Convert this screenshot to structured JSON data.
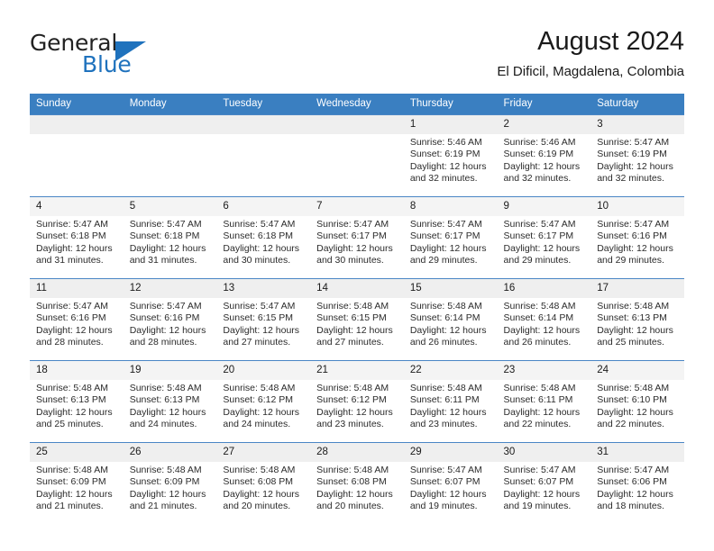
{
  "brand": {
    "name_part1": "General",
    "name_part2": "Blue",
    "accent_color": "#1f72bd"
  },
  "header": {
    "title": "August 2024",
    "subtitle": "El Dificil, Magdalena, Colombia"
  },
  "calendar": {
    "header_bg": "#3a7fc1",
    "weekday_headers": [
      "Sunday",
      "Monday",
      "Tuesday",
      "Wednesday",
      "Thursday",
      "Friday",
      "Saturday"
    ],
    "weeks": [
      [
        {
          "day": "",
          "empty": true,
          "sunrise": "",
          "sunset": "",
          "daylight1": "",
          "daylight2": ""
        },
        {
          "day": "",
          "empty": true,
          "sunrise": "",
          "sunset": "",
          "daylight1": "",
          "daylight2": ""
        },
        {
          "day": "",
          "empty": true,
          "sunrise": "",
          "sunset": "",
          "daylight1": "",
          "daylight2": ""
        },
        {
          "day": "",
          "empty": true,
          "sunrise": "",
          "sunset": "",
          "daylight1": "",
          "daylight2": ""
        },
        {
          "day": "1",
          "sunrise": "Sunrise: 5:46 AM",
          "sunset": "Sunset: 6:19 PM",
          "daylight1": "Daylight: 12 hours",
          "daylight2": "and 32 minutes."
        },
        {
          "day": "2",
          "sunrise": "Sunrise: 5:46 AM",
          "sunset": "Sunset: 6:19 PM",
          "daylight1": "Daylight: 12 hours",
          "daylight2": "and 32 minutes."
        },
        {
          "day": "3",
          "sunrise": "Sunrise: 5:47 AM",
          "sunset": "Sunset: 6:19 PM",
          "daylight1": "Daylight: 12 hours",
          "daylight2": "and 32 minutes."
        }
      ],
      [
        {
          "day": "4",
          "sunrise": "Sunrise: 5:47 AM",
          "sunset": "Sunset: 6:18 PM",
          "daylight1": "Daylight: 12 hours",
          "daylight2": "and 31 minutes."
        },
        {
          "day": "5",
          "sunrise": "Sunrise: 5:47 AM",
          "sunset": "Sunset: 6:18 PM",
          "daylight1": "Daylight: 12 hours",
          "daylight2": "and 31 minutes."
        },
        {
          "day": "6",
          "sunrise": "Sunrise: 5:47 AM",
          "sunset": "Sunset: 6:18 PM",
          "daylight1": "Daylight: 12 hours",
          "daylight2": "and 30 minutes."
        },
        {
          "day": "7",
          "sunrise": "Sunrise: 5:47 AM",
          "sunset": "Sunset: 6:17 PM",
          "daylight1": "Daylight: 12 hours",
          "daylight2": "and 30 minutes."
        },
        {
          "day": "8",
          "sunrise": "Sunrise: 5:47 AM",
          "sunset": "Sunset: 6:17 PM",
          "daylight1": "Daylight: 12 hours",
          "daylight2": "and 29 minutes."
        },
        {
          "day": "9",
          "sunrise": "Sunrise: 5:47 AM",
          "sunset": "Sunset: 6:17 PM",
          "daylight1": "Daylight: 12 hours",
          "daylight2": "and 29 minutes."
        },
        {
          "day": "10",
          "sunrise": "Sunrise: 5:47 AM",
          "sunset": "Sunset: 6:16 PM",
          "daylight1": "Daylight: 12 hours",
          "daylight2": "and 29 minutes."
        }
      ],
      [
        {
          "day": "11",
          "sunrise": "Sunrise: 5:47 AM",
          "sunset": "Sunset: 6:16 PM",
          "daylight1": "Daylight: 12 hours",
          "daylight2": "and 28 minutes."
        },
        {
          "day": "12",
          "sunrise": "Sunrise: 5:47 AM",
          "sunset": "Sunset: 6:16 PM",
          "daylight1": "Daylight: 12 hours",
          "daylight2": "and 28 minutes."
        },
        {
          "day": "13",
          "sunrise": "Sunrise: 5:47 AM",
          "sunset": "Sunset: 6:15 PM",
          "daylight1": "Daylight: 12 hours",
          "daylight2": "and 27 minutes."
        },
        {
          "day": "14",
          "sunrise": "Sunrise: 5:48 AM",
          "sunset": "Sunset: 6:15 PM",
          "daylight1": "Daylight: 12 hours",
          "daylight2": "and 27 minutes."
        },
        {
          "day": "15",
          "sunrise": "Sunrise: 5:48 AM",
          "sunset": "Sunset: 6:14 PM",
          "daylight1": "Daylight: 12 hours",
          "daylight2": "and 26 minutes."
        },
        {
          "day": "16",
          "sunrise": "Sunrise: 5:48 AM",
          "sunset": "Sunset: 6:14 PM",
          "daylight1": "Daylight: 12 hours",
          "daylight2": "and 26 minutes."
        },
        {
          "day": "17",
          "sunrise": "Sunrise: 5:48 AM",
          "sunset": "Sunset: 6:13 PM",
          "daylight1": "Daylight: 12 hours",
          "daylight2": "and 25 minutes."
        }
      ],
      [
        {
          "day": "18",
          "sunrise": "Sunrise: 5:48 AM",
          "sunset": "Sunset: 6:13 PM",
          "daylight1": "Daylight: 12 hours",
          "daylight2": "and 25 minutes."
        },
        {
          "day": "19",
          "sunrise": "Sunrise: 5:48 AM",
          "sunset": "Sunset: 6:13 PM",
          "daylight1": "Daylight: 12 hours",
          "daylight2": "and 24 minutes."
        },
        {
          "day": "20",
          "sunrise": "Sunrise: 5:48 AM",
          "sunset": "Sunset: 6:12 PM",
          "daylight1": "Daylight: 12 hours",
          "daylight2": "and 24 minutes."
        },
        {
          "day": "21",
          "sunrise": "Sunrise: 5:48 AM",
          "sunset": "Sunset: 6:12 PM",
          "daylight1": "Daylight: 12 hours",
          "daylight2": "and 23 minutes."
        },
        {
          "day": "22",
          "sunrise": "Sunrise: 5:48 AM",
          "sunset": "Sunset: 6:11 PM",
          "daylight1": "Daylight: 12 hours",
          "daylight2": "and 23 minutes."
        },
        {
          "day": "23",
          "sunrise": "Sunrise: 5:48 AM",
          "sunset": "Sunset: 6:11 PM",
          "daylight1": "Daylight: 12 hours",
          "daylight2": "and 22 minutes."
        },
        {
          "day": "24",
          "sunrise": "Sunrise: 5:48 AM",
          "sunset": "Sunset: 6:10 PM",
          "daylight1": "Daylight: 12 hours",
          "daylight2": "and 22 minutes."
        }
      ],
      [
        {
          "day": "25",
          "sunrise": "Sunrise: 5:48 AM",
          "sunset": "Sunset: 6:09 PM",
          "daylight1": "Daylight: 12 hours",
          "daylight2": "and 21 minutes."
        },
        {
          "day": "26",
          "sunrise": "Sunrise: 5:48 AM",
          "sunset": "Sunset: 6:09 PM",
          "daylight1": "Daylight: 12 hours",
          "daylight2": "and 21 minutes."
        },
        {
          "day": "27",
          "sunrise": "Sunrise: 5:48 AM",
          "sunset": "Sunset: 6:08 PM",
          "daylight1": "Daylight: 12 hours",
          "daylight2": "and 20 minutes."
        },
        {
          "day": "28",
          "sunrise": "Sunrise: 5:48 AM",
          "sunset": "Sunset: 6:08 PM",
          "daylight1": "Daylight: 12 hours",
          "daylight2": "and 20 minutes."
        },
        {
          "day": "29",
          "sunrise": "Sunrise: 5:47 AM",
          "sunset": "Sunset: 6:07 PM",
          "daylight1": "Daylight: 12 hours",
          "daylight2": "and 19 minutes."
        },
        {
          "day": "30",
          "sunrise": "Sunrise: 5:47 AM",
          "sunset": "Sunset: 6:07 PM",
          "daylight1": "Daylight: 12 hours",
          "daylight2": "and 19 minutes."
        },
        {
          "day": "31",
          "sunrise": "Sunrise: 5:47 AM",
          "sunset": "Sunset: 6:06 PM",
          "daylight1": "Daylight: 12 hours",
          "daylight2": "and 18 minutes."
        }
      ]
    ]
  }
}
